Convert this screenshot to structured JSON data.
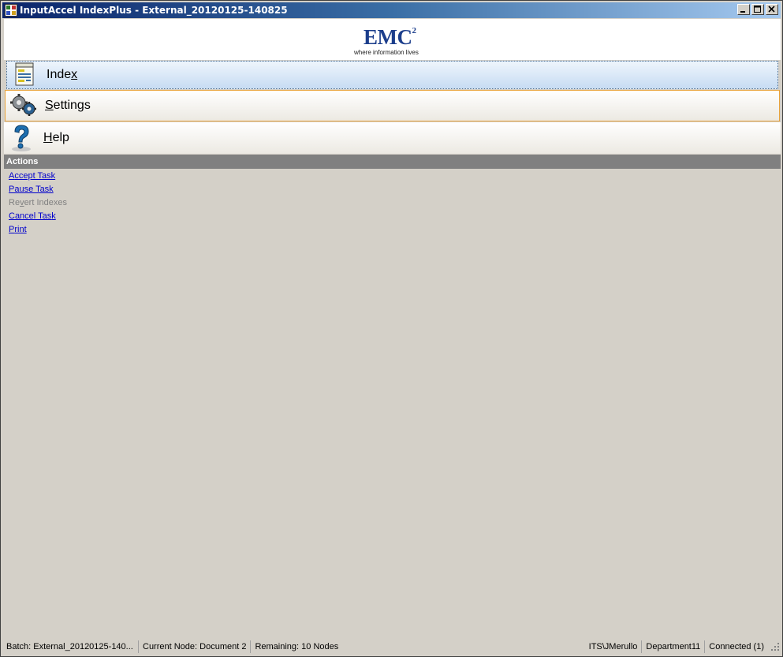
{
  "window": {
    "title": "InputAccel IndexPlus - External_20120125-140825",
    "icon": "app-grid-icon"
  },
  "logo": {
    "brand": "EMC",
    "superscript": "2",
    "tagline": "where information lives"
  },
  "nav": {
    "index": {
      "pre": "Inde",
      "mnemonic": "x",
      "post": "",
      "icon": "document-icon"
    },
    "settings": {
      "pre": "",
      "mnemonic": "S",
      "post": "ettings",
      "icon": "gears-icon"
    },
    "help": {
      "pre": "",
      "mnemonic": "H",
      "post": "elp",
      "icon": "question-mark-icon"
    }
  },
  "actions": {
    "header": "Actions",
    "items": [
      {
        "pre": "",
        "mnemonic": "A",
        "post": "ccept Task",
        "enabled": true
      },
      {
        "pre": "Pa",
        "mnemonic": "u",
        "post": "se Task",
        "enabled": true
      },
      {
        "pre": "Re",
        "mnemonic": "v",
        "post": "ert Indexes",
        "enabled": false
      },
      {
        "pre": "Cancel Tas",
        "mnemonic": "k",
        "post": "",
        "enabled": true
      },
      {
        "pre": "P",
        "mnemonic": "r",
        "post": "int",
        "enabled": true
      }
    ]
  },
  "status": {
    "batch": "Batch: External_20120125-140...",
    "current_node": "Current Node: Document 2",
    "remaining": "Remaining: 10 Nodes",
    "user": "ITS\\JMerullo",
    "department": "Department11",
    "connection": "Connected (1)"
  },
  "colors": {
    "title_start": "#0a246a",
    "link": "#0000cc",
    "disabled": "#808080",
    "settings_border": "#e8a33c",
    "emc_blue": "#1c3e8c"
  }
}
